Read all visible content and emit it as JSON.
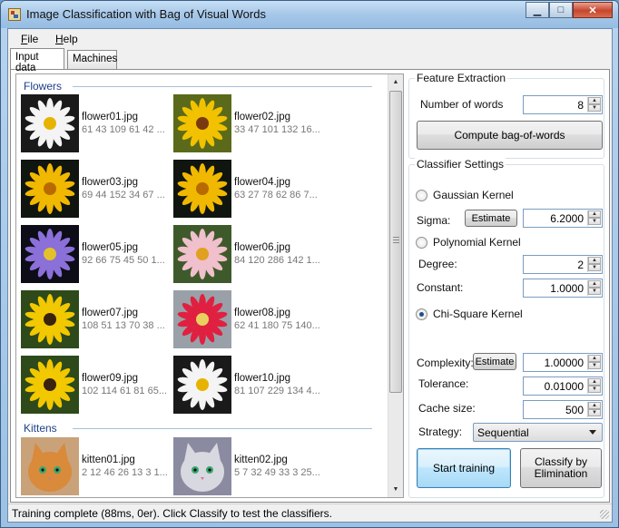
{
  "window": {
    "title": "Image Classification with Bag of Visual Words",
    "minimize_glyph": "▁",
    "maximize_glyph": "□",
    "close_glyph": "✕"
  },
  "menu": {
    "file": {
      "first": "F",
      "rest": "ile"
    },
    "help": {
      "first": "H",
      "rest": "elp"
    }
  },
  "tabs": {
    "input_data": "Input data",
    "machines": "Machines"
  },
  "groups": {
    "flowers": "Flowers",
    "kittens": "Kittens"
  },
  "flowers": [
    {
      "name": "flower01.jpg",
      "desc": "61 43 109 61 42 ...",
      "icon": "white-daisy"
    },
    {
      "name": "flower02.jpg",
      "desc": "33 47 101 132 16...",
      "icon": "yellow-sunflower"
    },
    {
      "name": "flower03.jpg",
      "desc": "69 44 152 34 67 ...",
      "icon": "yellow-flower"
    },
    {
      "name": "flower04.jpg",
      "desc": "63 27 78 62 86 7...",
      "icon": "yellow-flower"
    },
    {
      "name": "flower05.jpg",
      "desc": "92 66 75 45 50 1...",
      "icon": "purple-aster"
    },
    {
      "name": "flower06.jpg",
      "desc": "84 120 286 142 1...",
      "icon": "pink-daisy"
    },
    {
      "name": "flower07.jpg",
      "desc": "108 51 13 70 38 ...",
      "icon": "black-eyed-susan"
    },
    {
      "name": "flower08.jpg",
      "desc": "62 41 180 75 140...",
      "icon": "red-gerbera"
    },
    {
      "name": "flower09.jpg",
      "desc": "102 114 61 81 65...",
      "icon": "black-eyed-susan"
    },
    {
      "name": "flower10.jpg",
      "desc": "81 107 229 134 4...",
      "icon": "white-daisy"
    }
  ],
  "kittens": [
    {
      "name": "kitten01.jpg",
      "desc": "2 12 46 26 13 3 1...",
      "icon": "orange-kitten"
    },
    {
      "name": "kitten02.jpg",
      "desc": "5 7 32 49 33 3 25...",
      "icon": "gray-kitten"
    }
  ],
  "feature_extraction": {
    "title": "Feature Extraction",
    "num_words_label": "Number of words",
    "num_words_value": "8",
    "compute_button": "Compute bag-of-words"
  },
  "classifier": {
    "title": "Classifier Settings",
    "gaussian_label": "Gaussian Kernel",
    "sigma_label": "Sigma:",
    "estimate_label": "Estimate",
    "sigma_value": "6.2000",
    "polynomial_label": "Polynomial Kernel",
    "degree_label": "Degree:",
    "degree_value": "2",
    "constant_label": "Constant:",
    "constant_value": "1.0000",
    "chisquare_label": "Chi-Square Kernel",
    "complexity_label": "Complexity:",
    "complexity_value": "1.00000",
    "tolerance_label": "Tolerance:",
    "tolerance_value": "0.01000",
    "cache_label": "Cache size:",
    "cache_value": "500",
    "strategy_label": "Strategy:",
    "strategy_value": "Sequential",
    "selected_kernel": "chi-square"
  },
  "actions": {
    "start_training": "Start training",
    "classify": "Classify by Elimination"
  },
  "status": {
    "text": "Training complete (88ms, 0er). Click Classify to test the classifiers."
  }
}
